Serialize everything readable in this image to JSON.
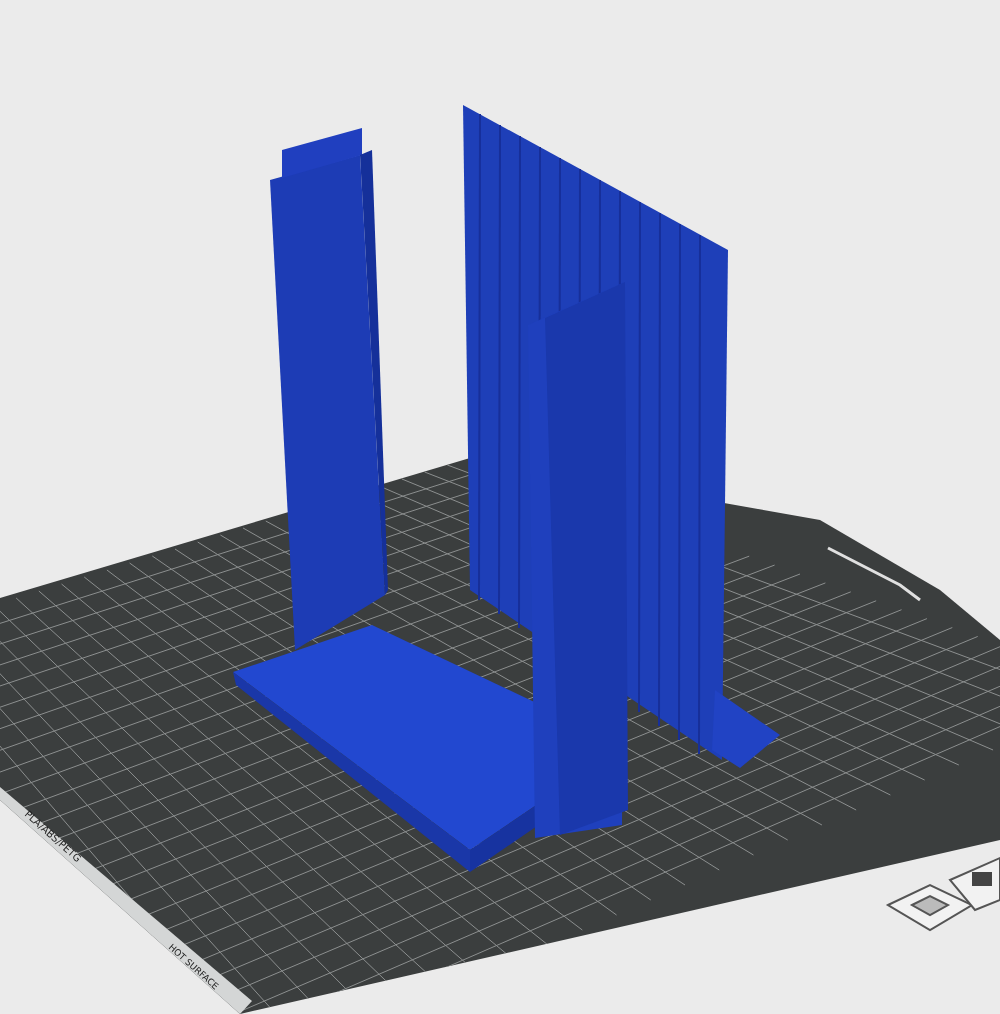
{
  "viewport": {
    "bed": {
      "material_label": "PLA/ABS/PETG",
      "warning_label": "HOT SURFACE"
    }
  }
}
